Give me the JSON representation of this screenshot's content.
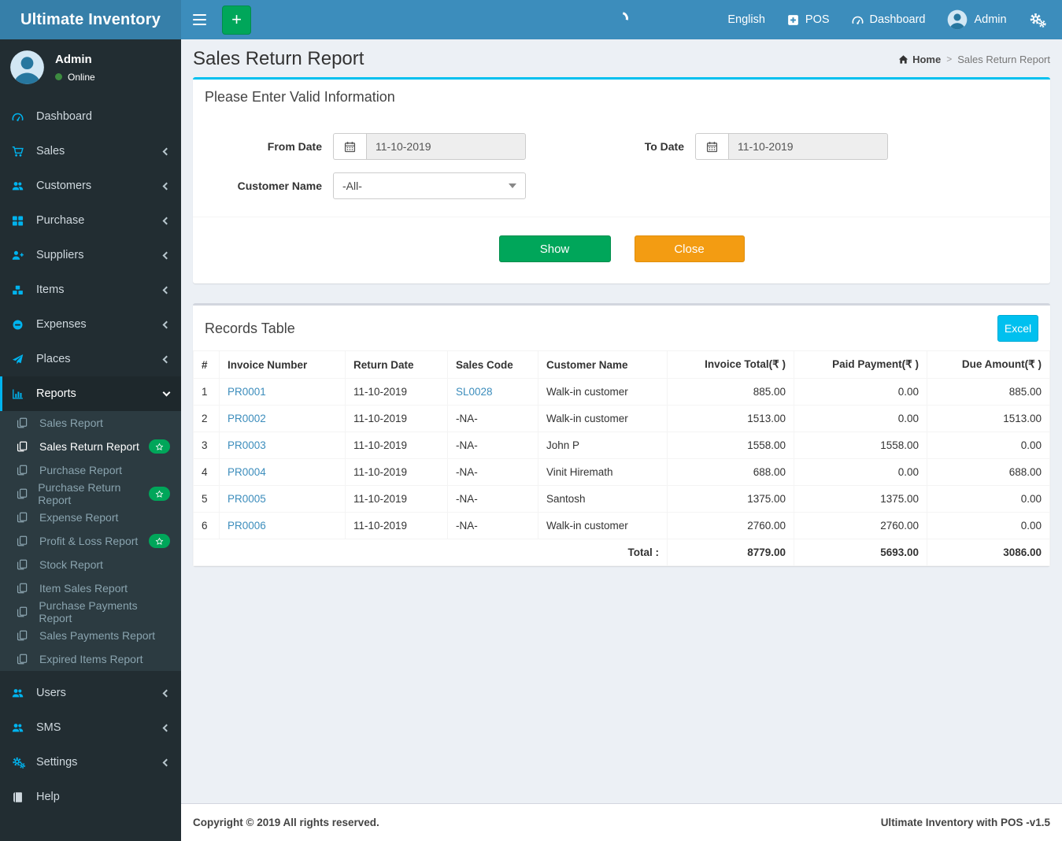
{
  "brand": {
    "title": "Ultimate Inventory"
  },
  "navbar": {
    "language": "English",
    "pos_label": "POS",
    "dashboard_label": "Dashboard",
    "user_label": "Admin"
  },
  "sidebar": {
    "user": {
      "name": "Admin",
      "status": "Online"
    },
    "items": [
      {
        "name": "sidebar-item-dashboard",
        "label": "Dashboard",
        "icon": "tachometer"
      },
      {
        "name": "sidebar-item-sales",
        "label": "Sales",
        "icon": "cart",
        "chevron": "left"
      },
      {
        "name": "sidebar-item-customers",
        "label": "Customers",
        "icon": "users",
        "chevron": "left"
      },
      {
        "name": "sidebar-item-purchase",
        "label": "Purchase",
        "icon": "th-large",
        "chevron": "left"
      },
      {
        "name": "sidebar-item-suppliers",
        "label": "Suppliers",
        "icon": "user-plus",
        "chevron": "left"
      },
      {
        "name": "sidebar-item-items",
        "label": "Items",
        "icon": "cubes",
        "chevron": "left"
      },
      {
        "name": "sidebar-item-expenses",
        "label": "Expenses",
        "icon": "minus-circle",
        "chevron": "left"
      },
      {
        "name": "sidebar-item-places",
        "label": "Places",
        "icon": "paper-plane",
        "chevron": "left"
      },
      {
        "name": "sidebar-item-reports",
        "label": "Reports",
        "icon": "bar-chart",
        "chevron": "down",
        "active": true
      }
    ],
    "reports_submenu": [
      {
        "name": "sidebar-subitem-sales-report",
        "label": "Sales Report",
        "icon": "copy"
      },
      {
        "name": "sidebar-subitem-sales-return-report",
        "label": "Sales Return Report",
        "icon": "copy",
        "active": true,
        "badge": "star"
      },
      {
        "name": "sidebar-subitem-purchase-report",
        "label": "Purchase Report",
        "icon": "copy"
      },
      {
        "name": "sidebar-subitem-purchase-return-report",
        "label": "Purchase Return Report",
        "icon": "copy",
        "badge": "star"
      },
      {
        "name": "sidebar-subitem-expense-report",
        "label": "Expense Report",
        "icon": "copy"
      },
      {
        "name": "sidebar-subitem-profit-loss-report",
        "label": "Profit & Loss Report",
        "icon": "copy",
        "badge": "star"
      },
      {
        "name": "sidebar-subitem-stock-report",
        "label": "Stock Report",
        "icon": "copy"
      },
      {
        "name": "sidebar-subitem-item-sales-report",
        "label": "Item Sales Report",
        "icon": "copy"
      },
      {
        "name": "sidebar-subitem-purchase-payments-report",
        "label": "Purchase Payments Report",
        "icon": "copy"
      },
      {
        "name": "sidebar-subitem-sales-payments-report",
        "label": "Sales Payments Report",
        "icon": "copy"
      },
      {
        "name": "sidebar-subitem-expired-items-report",
        "label": "Expired Items Report",
        "icon": "copy"
      }
    ],
    "items_bottom": [
      {
        "name": "sidebar-item-users",
        "label": "Users",
        "icon": "users",
        "chevron": "left"
      },
      {
        "name": "sidebar-item-sms",
        "label": "SMS",
        "icon": "users",
        "chevron": "left"
      },
      {
        "name": "sidebar-item-settings",
        "label": "Settings",
        "icon": "gears",
        "chevron": "left"
      },
      {
        "name": "sidebar-item-help",
        "label": "Help",
        "icon": "book"
      }
    ]
  },
  "page": {
    "title": "Sales Return Report",
    "breadcrumb_home": "Home",
    "breadcrumb_sep": ">",
    "breadcrumb_current": "Sales Return Report"
  },
  "filter": {
    "title": "Please Enter Valid Information",
    "from_date_label": "From Date",
    "from_date": "11-10-2019",
    "to_date_label": "To Date",
    "to_date": "11-10-2019",
    "customer_label": "Customer Name",
    "customer_value": "-All-",
    "show_label": "Show",
    "close_label": "Close"
  },
  "records": {
    "title": "Records Table",
    "excel_label": "Excel",
    "columns": [
      {
        "label": "#"
      },
      {
        "label": "Invoice Number"
      },
      {
        "label": "Return Date"
      },
      {
        "label": "Sales Code"
      },
      {
        "label": "Customer Name"
      },
      {
        "label": "Invoice Total(₹ )",
        "align": "right"
      },
      {
        "label": "Paid Payment(₹ )",
        "align": "right"
      },
      {
        "label": "Due Amount(₹ )",
        "align": "right"
      }
    ],
    "rows": [
      {
        "num": "1",
        "invoice": "PR0001",
        "date": "11-10-2019",
        "code": "SL0028",
        "code_class": "code-link",
        "customer": "Walk-in customer",
        "total": "885.00",
        "paid": "0.00",
        "due": "885.00"
      },
      {
        "num": "2",
        "invoice": "PR0002",
        "date": "11-10-2019",
        "code": "-NA-",
        "code_class": "code-plain",
        "customer": "Walk-in customer",
        "total": "1513.00",
        "paid": "0.00",
        "due": "1513.00"
      },
      {
        "num": "3",
        "invoice": "PR0003",
        "date": "11-10-2019",
        "code": "-NA-",
        "code_class": "code-plain",
        "customer": "John P",
        "total": "1558.00",
        "paid": "1558.00",
        "due": "0.00"
      },
      {
        "num": "4",
        "invoice": "PR0004",
        "date": "11-10-2019",
        "code": "-NA-",
        "code_class": "code-plain",
        "customer": "Vinit Hiremath",
        "total": "688.00",
        "paid": "0.00",
        "due": "688.00"
      },
      {
        "num": "5",
        "invoice": "PR0005",
        "date": "11-10-2019",
        "code": "-NA-",
        "code_class": "code-plain",
        "customer": "Santosh",
        "total": "1375.00",
        "paid": "1375.00",
        "due": "0.00"
      },
      {
        "num": "6",
        "invoice": "PR0006",
        "date": "11-10-2019",
        "code": "-NA-",
        "code_class": "code-plain",
        "customer": "Walk-in customer",
        "total": "2760.00",
        "paid": "2760.00",
        "due": "0.00"
      }
    ],
    "total_label": "Total :",
    "totals": {
      "total": "8779.00",
      "paid": "5693.00",
      "due": "3086.00"
    }
  },
  "footer": {
    "copyright": "Copyright © 2019 All rights reserved.",
    "version": "Ultimate Inventory with POS -v1.5"
  },
  "colors": {
    "navbar": "#3c8dbc",
    "brand": "#367fa9",
    "sidebar": "#222d32",
    "submenu": "#2c3b41",
    "accent_cyan": "#00c0ef",
    "icon_blue": "#00b3ee",
    "green": "#00a65a",
    "orange": "#f39c12",
    "link": "#3c8dbc",
    "content_bg": "#ecf0f5"
  }
}
